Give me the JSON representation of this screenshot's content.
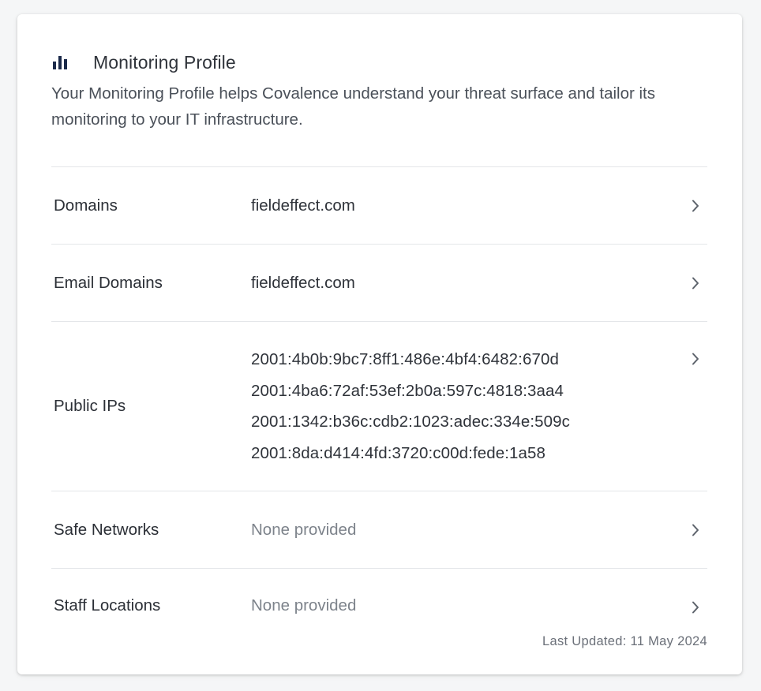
{
  "header": {
    "icon": "bar-chart-icon",
    "title": "Monitoring Profile",
    "description": "Your Monitoring Profile helps Covalence understand your threat surface and tailor its monitoring to your IT infrastructure."
  },
  "rows": [
    {
      "label": "Domains",
      "value": "fieldeffect.com"
    },
    {
      "label": "Email Domains",
      "value": "fieldeffect.com"
    },
    {
      "label": "Public IPs",
      "values": [
        "2001:4b0b:9bc7:8ff1:486e:4bf4:6482:670d",
        "2001:4ba6:72af:53ef:2b0a:597c:4818:3aa4",
        "2001:1342:b36c:cdb2:1023:adec:334e:509c",
        "2001:8da:d414:4fd:3720:c00d:fede:1a58"
      ]
    },
    {
      "label": "Safe Networks",
      "value": "None provided"
    },
    {
      "label": "Staff Locations",
      "value": "None provided"
    }
  ],
  "footer": {
    "last_updated": "Last Updated: 11 May 2024"
  },
  "colors": {
    "icon": "#1b2a4a",
    "muted_text": "#7d838b",
    "divider": "#e4e6e9"
  }
}
